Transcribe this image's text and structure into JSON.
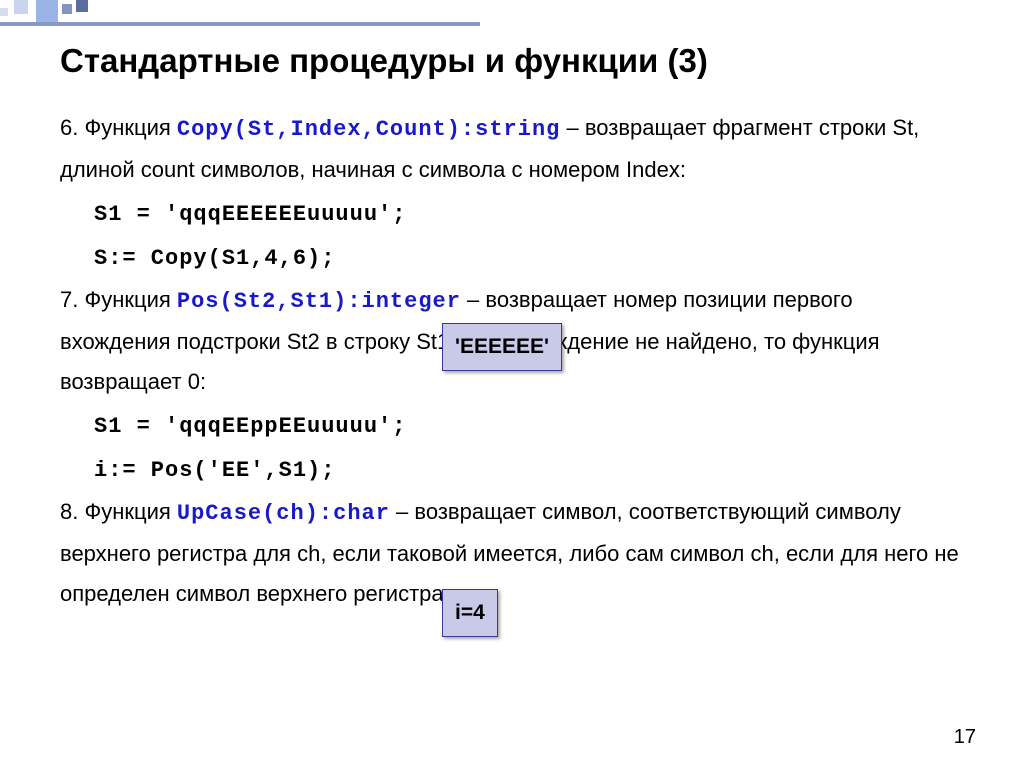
{
  "title": "Стандартные процедуры и функции (3)",
  "item6": {
    "num": "6.",
    "lead": " Функция ",
    "sig": "Copy(St,Index,Count):string",
    "desc": " – возвращает фрагмент строки St, длиной count символов, начиная с символа с номером Index:",
    "code1": "S1 = 'qqqEEEEEEuuuuu';",
    "code2": "S:= Copy(S1,4,6);",
    "result": "'EEEEEE'"
  },
  "item7": {
    "num": "7.",
    "lead": " Функция ",
    "sig": "Pos(St2,St1):integer",
    "desc": " – возвращает номер позиции первого вхождения подстроки St2 в строку St1. Если вхождение не найдено, то функция возвращает 0:",
    "code1": "S1 = 'qqqEEppEEuuuuu';",
    "code2": "i:= Pos('EE',S1);",
    "result": "i=4"
  },
  "item8": {
    "num": "8.",
    "lead": " Функция ",
    "sig": "UpCase(ch):char",
    "desc": " – возвращает символ, соответствующий символу верхнего регистра для ch, если таковой имеется, либо сам символ ch, если для него не определен символ верхнего регистра",
    "dot": "."
  },
  "page_number": "17"
}
